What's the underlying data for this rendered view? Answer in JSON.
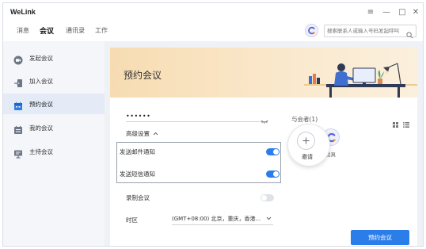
{
  "app": {
    "title": "WeLink",
    "window_controls": [
      "≡",
      "—",
      "□",
      "✕"
    ]
  },
  "nav": {
    "tabs": [
      {
        "label": "消息",
        "active": false
      },
      {
        "label": "会议",
        "active": true
      },
      {
        "label": "通讯录",
        "active": false
      },
      {
        "label": "工作",
        "active": false
      }
    ],
    "search_placeholder": "搜索联系人或输入号码发起呼叫",
    "avatar_icon": "welink-logo-icon"
  },
  "sidebar": {
    "items": [
      {
        "label": "发起会议",
        "icon": "video-call-icon",
        "active": false
      },
      {
        "label": "加入会议",
        "icon": "join-meeting-icon",
        "active": false
      },
      {
        "label": "预约会议",
        "icon": "calendar-icon",
        "active": true
      },
      {
        "label": "我的会议",
        "icon": "calendar-list-icon",
        "active": false
      },
      {
        "label": "主持会议",
        "icon": "presentation-icon",
        "active": false
      }
    ]
  },
  "main": {
    "banner_title": "预约会议",
    "password": {
      "value": "••••••",
      "icon": "eye-closed-icon"
    },
    "advanced": {
      "label": "高级设置",
      "expanded": true
    },
    "settings": [
      {
        "label": "发送邮件通知",
        "enabled": true
      },
      {
        "label": "发送短信通知",
        "enabled": true
      },
      {
        "label": "录制会议",
        "enabled": false
      }
    ],
    "timezone": {
      "label": "时区",
      "value": "(GMT+08:00) 北京，重庆，香港..."
    },
    "attendees": {
      "label": "与会者(1)",
      "invite_label": "邀请",
      "members": [
        {
          "name": "我真"
        }
      ]
    },
    "book_button": "预约会议"
  },
  "colors": {
    "accent": "#2b7de9",
    "sidebar_bg": "#f4f6f9",
    "sidebar_active": "#e4ebf6",
    "banner": "#f7dcb2"
  }
}
